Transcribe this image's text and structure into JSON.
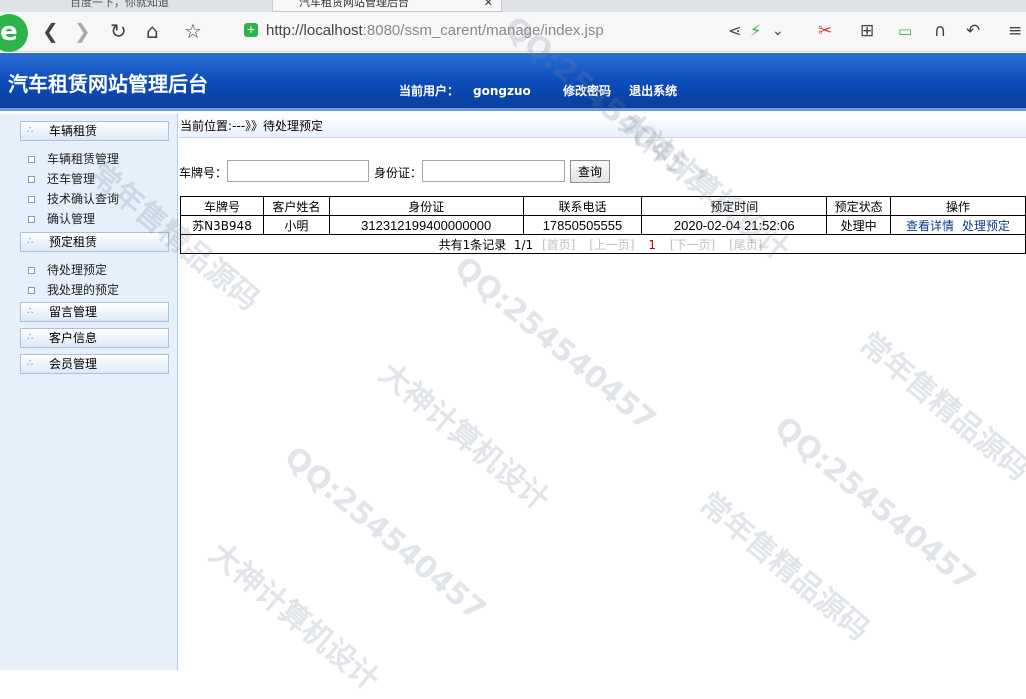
{
  "browser": {
    "tab1_title": "百度一下，你就知道",
    "tab2_title": "汽车租赁网站管理后台",
    "url_host": "http://localhost",
    "url_rest": ":8080/ssm_carent/manage/index.jsp"
  },
  "header": {
    "title": "汽车租赁网站管理后台",
    "current_user_label": "当前用户：",
    "current_user": "gongzuo",
    "change_password": "修改密码",
    "logout": "退出系统"
  },
  "sidebar": {
    "groups": [
      {
        "label": "车辆租赁",
        "items": [
          "车辆租赁管理",
          "还车管理",
          "技术确认查询",
          "确认管理"
        ]
      },
      {
        "label": "预定租赁",
        "items": [
          "待处理预定",
          "我处理的预定"
        ]
      },
      {
        "label": "留言管理",
        "items": []
      },
      {
        "label": "客户信息",
        "items": []
      },
      {
        "label": "会员管理",
        "items": []
      }
    ]
  },
  "breadcrumb": "当前位置:---》》待处理预定",
  "search": {
    "plate_label": "车牌号：",
    "plate_value": "",
    "id_label": "身份证：",
    "id_value": "",
    "button": "查询"
  },
  "table": {
    "headers": [
      "车牌号",
      "客户姓名",
      "身份证",
      "联系电话",
      "预定时间",
      "预定状态",
      "操作"
    ],
    "rows": [
      {
        "plate": "苏N3B948",
        "name": "小明",
        "id_card": "312312199400000000",
        "phone": "17850505555",
        "time": "2020-02-04 21:52:06",
        "status": "处理中",
        "op_view": "查看详情",
        "op_handle": "处理预定"
      }
    ],
    "pager": {
      "summary": "共有1条记录",
      "pages": "1/1",
      "first": "[首页]",
      "prev": "[上一页]",
      "current": "1",
      "next": "[下一页]",
      "last": "[尾页]"
    }
  },
  "watermark": {
    "texts": [
      "QQ:254540457",
      "大神计算机设计",
      "常年售精品源码"
    ]
  }
}
